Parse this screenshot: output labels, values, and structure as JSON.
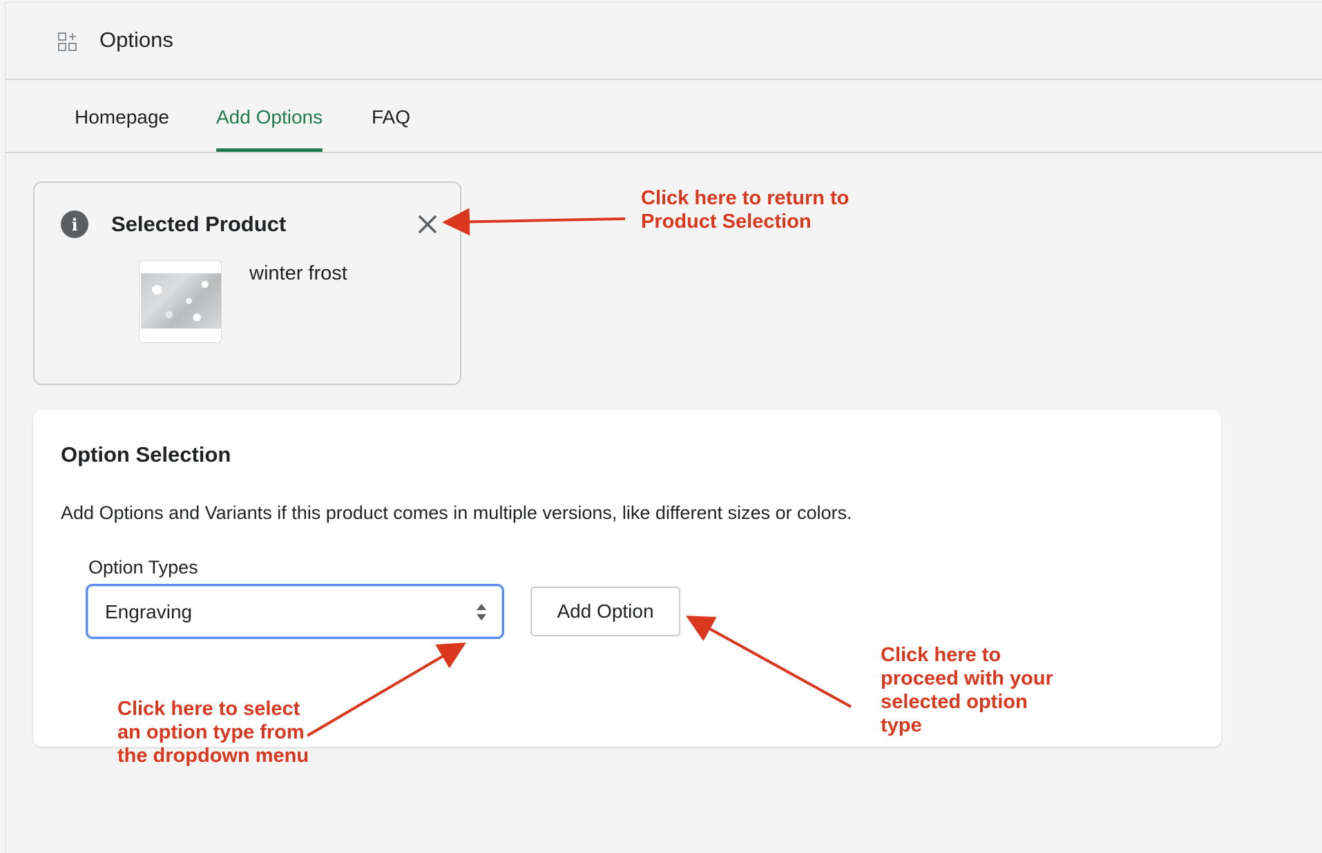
{
  "header": {
    "app_title": "Options",
    "app_icon": "apps-add-icon"
  },
  "tabs": [
    {
      "label": "Homepage",
      "active": false
    },
    {
      "label": "Add Options",
      "active": true
    },
    {
      "label": "FAQ",
      "active": false
    }
  ],
  "selected_product": {
    "title": "Selected Product",
    "product_name": "winter frost",
    "info_icon": "info-icon",
    "close_icon": "close-icon"
  },
  "option_selection": {
    "title": "Option Selection",
    "description": "Add Options and Variants if this product comes in multiple versions, like different sizes or colors.",
    "option_types_label": "Option Types",
    "selected_option": "Engraving",
    "add_button_label": "Add Option"
  },
  "annotations": {
    "close": "Click here to return to Product Selection",
    "dropdown": "Click here to select an option type from the dropdown menu",
    "add": "Click here to proceed with your selected option type"
  },
  "colors": {
    "accent": "#1f7a50",
    "annotation": "#d9381e",
    "focus_ring": "#5b8def"
  }
}
